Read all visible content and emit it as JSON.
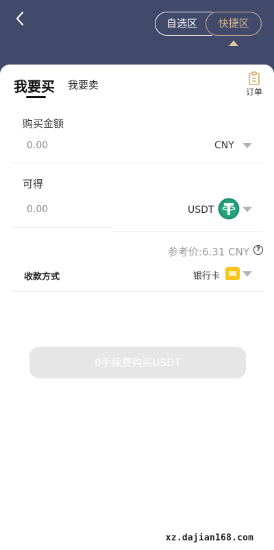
{
  "header": {
    "back_icon": "chevron-left-icon",
    "segments": [
      "自选区",
      "快捷区"
    ],
    "active_segment": "快捷区",
    "background_color": "#414a6b",
    "accent_color": "#d2b48c"
  },
  "tabs": {
    "buy_label": "我要买",
    "sell_label": "我要卖",
    "active": "我要买"
  },
  "orders": {
    "icon": "clipboard-order-icon",
    "label": "订单"
  },
  "form": {
    "amount_label": "购买金额",
    "amount_placeholder": "0.00",
    "amount_currency": "CNY",
    "receive_label": "可得",
    "receive_placeholder": "0.00",
    "receive_currency": "USDT",
    "receive_currency_icon": "tether-icon",
    "reference_price": "参考价:6.31 CNY",
    "help_icon": "question-circle-icon",
    "payment_label": "收款方式",
    "payment_value": "银行卡",
    "payment_icon": "bank-card-icon"
  },
  "submit_label": "0手续费购买USDT",
  "watermark": "xz.dajian168.com"
}
